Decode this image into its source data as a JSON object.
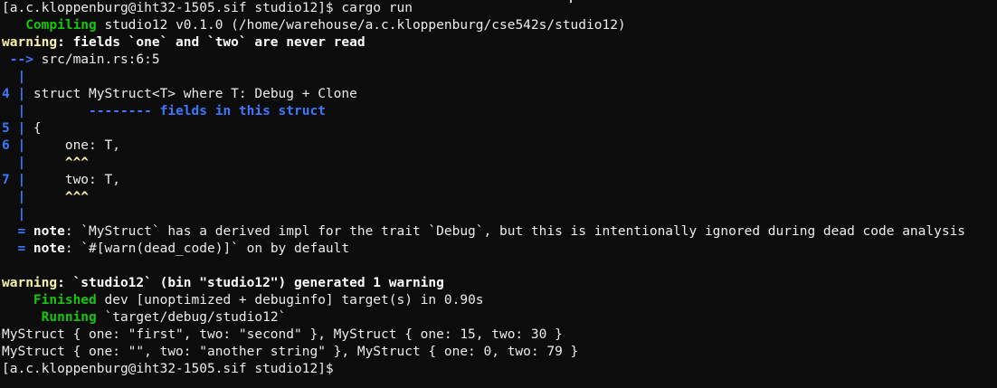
{
  "terminal": {
    "lines": [
      [
        {
          "t": "[a.c.kloppenburg@iht32-1505.sif studio12]$ cargo run",
          "c": ""
        }
      ],
      [
        {
          "t": "   Compiling",
          "c": "green"
        },
        {
          "t": " studio12 v0.1.0 (/home/warehouse/a.c.kloppenburg/cse542s/studio12)",
          "c": ""
        }
      ],
      [
        {
          "t": "warning",
          "c": "yellow"
        },
        {
          "t": ": fields `one` and `two` are never read",
          "c": "bold"
        }
      ],
      [
        {
          "t": " -->",
          "c": "blue"
        },
        {
          "t": " src/main.rs:6:5",
          "c": ""
        }
      ],
      [
        {
          "t": "  |",
          "c": "blue"
        }
      ],
      [
        {
          "t": "4 |",
          "c": "blue"
        },
        {
          "t": " struct MyStruct<T> where T: Debug + Clone",
          "c": ""
        }
      ],
      [
        {
          "t": "  |",
          "c": "blue"
        },
        {
          "t": "        -------- fields in this struct",
          "c": "blue"
        }
      ],
      [
        {
          "t": "5 |",
          "c": "blue"
        },
        {
          "t": " {",
          "c": ""
        }
      ],
      [
        {
          "t": "6 |",
          "c": "blue"
        },
        {
          "t": "     one: T,",
          "c": ""
        }
      ],
      [
        {
          "t": "  |",
          "c": "blue"
        },
        {
          "t": "     ^^^",
          "c": "caret"
        }
      ],
      [
        {
          "t": "7 |",
          "c": "blue"
        },
        {
          "t": "     two: T,",
          "c": ""
        }
      ],
      [
        {
          "t": "  |",
          "c": "blue"
        },
        {
          "t": "     ^^^",
          "c": "caret"
        }
      ],
      [
        {
          "t": "  |",
          "c": "blue"
        }
      ],
      [
        {
          "t": "  = ",
          "c": "blue"
        },
        {
          "t": "note",
          "c": "bold"
        },
        {
          "t": ": `MyStruct` has a derived impl for the trait `Debug`, but this is intentionally ignored during dead code analysis",
          "c": ""
        }
      ],
      [
        {
          "t": "  = ",
          "c": "blue"
        },
        {
          "t": "note",
          "c": "bold"
        },
        {
          "t": ": `#[warn(dead_code)]` on by default",
          "c": ""
        }
      ],
      [
        {
          "t": "",
          "c": ""
        }
      ],
      [
        {
          "t": "warning",
          "c": "yellow"
        },
        {
          "t": ": `studio12` (bin \"studio12\") generated 1 warning",
          "c": "bold"
        }
      ],
      [
        {
          "t": "    Finished",
          "c": "green"
        },
        {
          "t": " dev [unoptimized + debuginfo] target(s) in 0.90s",
          "c": ""
        }
      ],
      [
        {
          "t": "     Running",
          "c": "green"
        },
        {
          "t": " `target/debug/studio12`",
          "c": ""
        }
      ],
      [
        {
          "t": "MyStruct { one: \"first\", two: \"second\" }, MyStruct { one: 15, two: 30 }",
          "c": ""
        }
      ],
      [
        {
          "t": "MyStruct { one: \"\", two: \"another string\" }, MyStruct { one: 0, two: 79 }",
          "c": ""
        }
      ],
      [
        {
          "t": "[a.c.kloppenburg@iht32-1505.sif studio12]$",
          "c": ""
        }
      ]
    ]
  },
  "colors": {
    "background": "#0c0c0c",
    "text": "#ececec",
    "green": "#16c60c",
    "yellow": "#f9f1a5",
    "blue": "#3b78ff"
  }
}
